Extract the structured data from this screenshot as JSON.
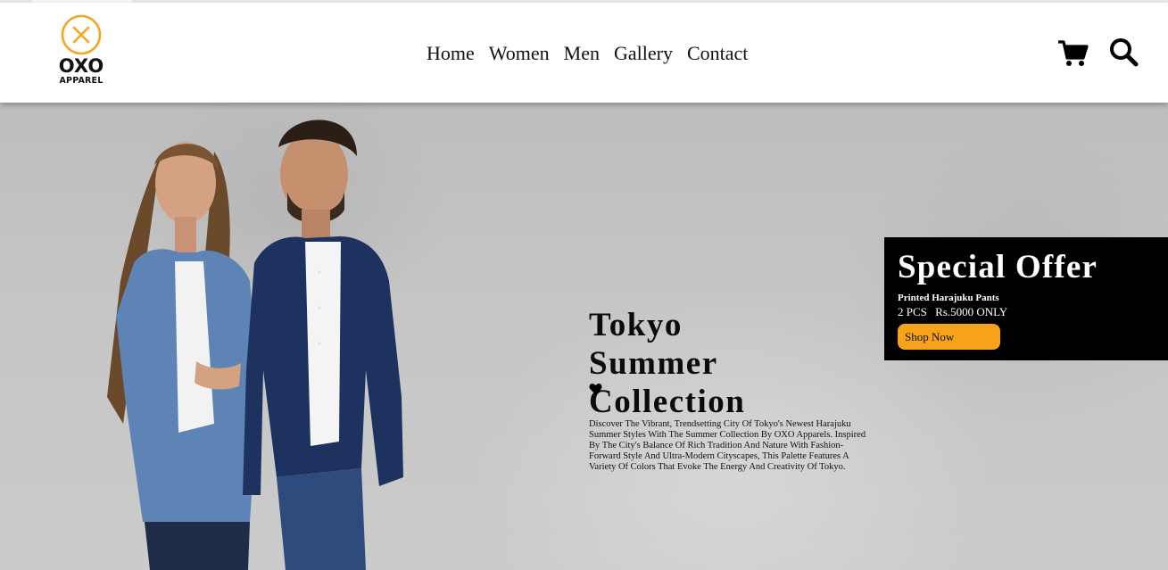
{
  "brand": {
    "name": "OXO",
    "tagline": "APPAREL",
    "accent": "#f5a623"
  },
  "nav": {
    "items": [
      "Home",
      "Women",
      "Men",
      "Gallery",
      "Contact"
    ]
  },
  "header_icons": [
    "cart-icon",
    "search-icon"
  ],
  "hero": {
    "title_lines": [
      "Tokyo",
      "Summer",
      "Collection"
    ],
    "description": "Discover The Vibrant, Trendsetting City Of Tokyo's Newest Harajuku Summer Styles With The Summer Collection By OXO Apparels. Inspired By The City's Balance Of Rich Tradition And Nature With Fashion-Forward Style And Ultra-Modern Cityscapes, This Palette Features A Variety Of Colors That Evoke The Energy And Creativity Of Tokyo.",
    "like_icon": "heart-icon"
  },
  "offer": {
    "title": "Special Offer",
    "product": "Printed Harajuku Pants",
    "quantity": "2 PCS",
    "price": "Rs.5000 ONLY",
    "button_label": "Shop Now",
    "button_color": "#f7a21b"
  }
}
